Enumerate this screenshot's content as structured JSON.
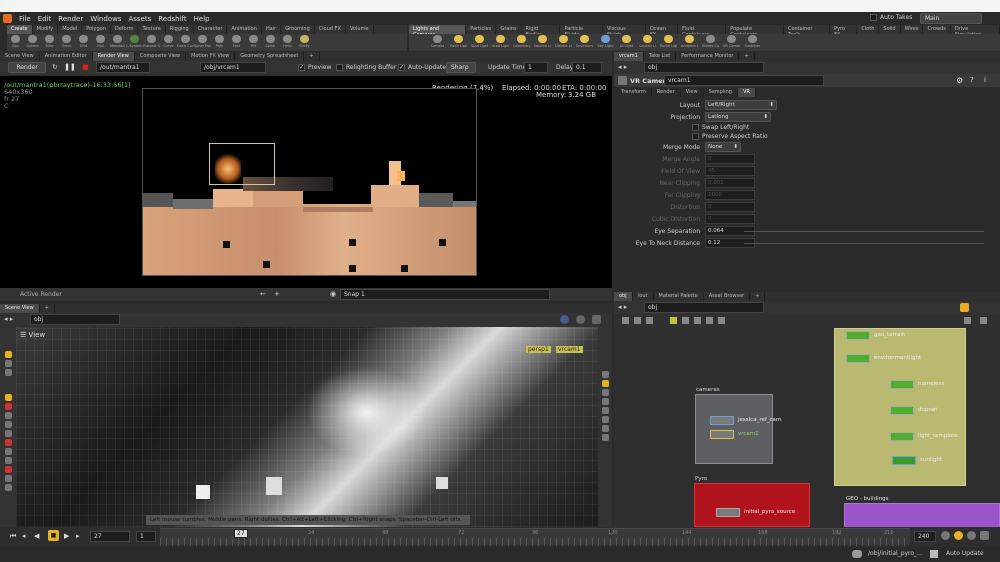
{
  "menu": {
    "items": [
      "File",
      "Edit",
      "Render",
      "Windows",
      "Assets",
      "Redshift",
      "Help"
    ],
    "auto_takes": "Auto Takes",
    "desk": "Main"
  },
  "shelf_left": {
    "tabs": [
      "Create",
      "Modify",
      "Model",
      "Polygon",
      "Deform",
      "Texture",
      "Rigging",
      "Character",
      "Animation",
      "Hair",
      "Grooming",
      "Cloud FX",
      "Volume"
    ],
    "tools": [
      "Box",
      "Sphere",
      "Tube",
      "Torus",
      "Grid",
      "Null",
      "Metaball",
      "L-System",
      "Platonic Sol..",
      "Curve",
      "Draw Curve",
      "Spray Paint",
      "Path",
      "Font",
      "File",
      "Spiral",
      "Helix",
      "Sticky"
    ]
  },
  "shelf_right": {
    "tabs": [
      "Lights and Cameras",
      "Particles",
      "Grains",
      "Rigid Bodies",
      "Particle Fluids",
      "Viscous Fluids",
      "Ocean FX",
      "Fluid Containers",
      "Populate Containers",
      "Container Tools",
      "Pyro FX",
      "Cloth",
      "Solid",
      "Wires",
      "Crowds",
      "Drive Simulation"
    ],
    "tools": [
      "Camera",
      "Point Light",
      "Spot Light",
      "Area Light",
      "Geometry L..",
      "Volume Light",
      "Distant Light",
      "Environme..",
      "Sky Light",
      "GI Light",
      "Caustic Light",
      "Portal Light",
      "Ambient Li..",
      "Stereo Cam..",
      "VR Camera",
      "Switcher"
    ]
  },
  "render_pane": {
    "tabs": [
      "Scene View",
      "Animation Editor",
      "Render View",
      "Composite View",
      "Motion FX View",
      "Geometry Spreadsheet"
    ],
    "render_btn": "Render",
    "output_path": "/out/mantra1",
    "camera_path": "/obj/vrcam1",
    "preview": "Preview",
    "relighting": "Relighting Buffer",
    "auto_update": "Auto-Update",
    "sharp": "Sharp",
    "update_time_label": "Update Time",
    "update_time": "1",
    "delay_label": "Delay",
    "delay": "0.1",
    "info_line1": "/out/mantra1(pbrraytrace)-16:33:56[1]",
    "info_line2": "640x360",
    "info_line3": "fr 27",
    "info_line4": "C",
    "status": "Rendering (7.4%)",
    "elapsed": "Elapsed: 0:00:00",
    "eta": "ETA: 0:00:00",
    "memory_label": "Memory:",
    "memory": "3.24 GB",
    "active_render": "Active Render",
    "snap": "Snap 1"
  },
  "params": {
    "tabs_top": [
      "vrcam1",
      "Take List",
      "Performance Monitor"
    ],
    "path": "obj",
    "node_type": "VR Camera",
    "node_name": "vrcam1",
    "tabs": [
      "Transform",
      "Render",
      "View",
      "Sampling",
      "VR"
    ],
    "layout_label": "Layout",
    "layout_value": "Left/Right",
    "projection_label": "Projection",
    "projection_value": "Latlong",
    "swap_label": "Swap Left/Right",
    "preserve_label": "Preserve Aspect Ratio",
    "merge_mode_label": "Merge Mode",
    "merge_mode_value": "None",
    "rows": [
      {
        "label": "Merge Angle",
        "value": "0",
        "dim": true
      },
      {
        "label": "Field Of View",
        "value": "45",
        "dim": true
      },
      {
        "label": "Near Clipping",
        "value": "0.001",
        "dim": true
      },
      {
        "label": "Far Clipping",
        "value": "1000",
        "dim": true
      },
      {
        "label": "Distortion",
        "value": "0",
        "dim": true
      },
      {
        "label": "Cubic Distortion",
        "value": "0",
        "dim": true
      },
      {
        "label": "Eye Separation",
        "value": "0.064",
        "dim": false
      },
      {
        "label": "Eye To Neck Distance",
        "value": "0.12",
        "dim": false
      }
    ]
  },
  "scene_view": {
    "tabs": [
      "Scene View"
    ],
    "path": "obj",
    "view_label": "View",
    "persp": "persp1",
    "cam": "vrcam1",
    "status": "Left mouse tumbles. Middle pans. Right dollies. Ctrl+Alt+Left+Clicking: Ctrl+Right snaps. Spacebar-Ctrl-Left tilts."
  },
  "network": {
    "tabs": [
      "obj",
      "/out",
      "Material Palette",
      "Asset Browser"
    ],
    "path": "obj",
    "nodes_top": [
      "geo_terrain",
      "environmentlight",
      "nameless",
      "dopnet",
      "light_template",
      "sunlight"
    ],
    "cameras_box": "cameras",
    "cam_nodes": [
      "jessica_ref_cam",
      "vrcam1"
    ],
    "pyro_box": "Pyro",
    "pyro_node": "initial_pyro_source",
    "geo_box": "GEO - buildings"
  },
  "timeline": {
    "current_frame": "27",
    "start": "1",
    "end": "240",
    "ticks": [
      "24",
      "48",
      "72",
      "96",
      "120",
      "144",
      "168",
      "192",
      "216"
    ],
    "frame_badge": "27",
    "end_field": "240",
    "status_path": "/obj/initial_pyro_...",
    "auto_update": "Auto Update"
  },
  "colors": {
    "accent": "#6fa2d6",
    "select_green": "#8bd35b",
    "pyro_red": "#b0131c",
    "geo_purple": "#9b55c9",
    "note_yellow": "#c0c07c"
  }
}
